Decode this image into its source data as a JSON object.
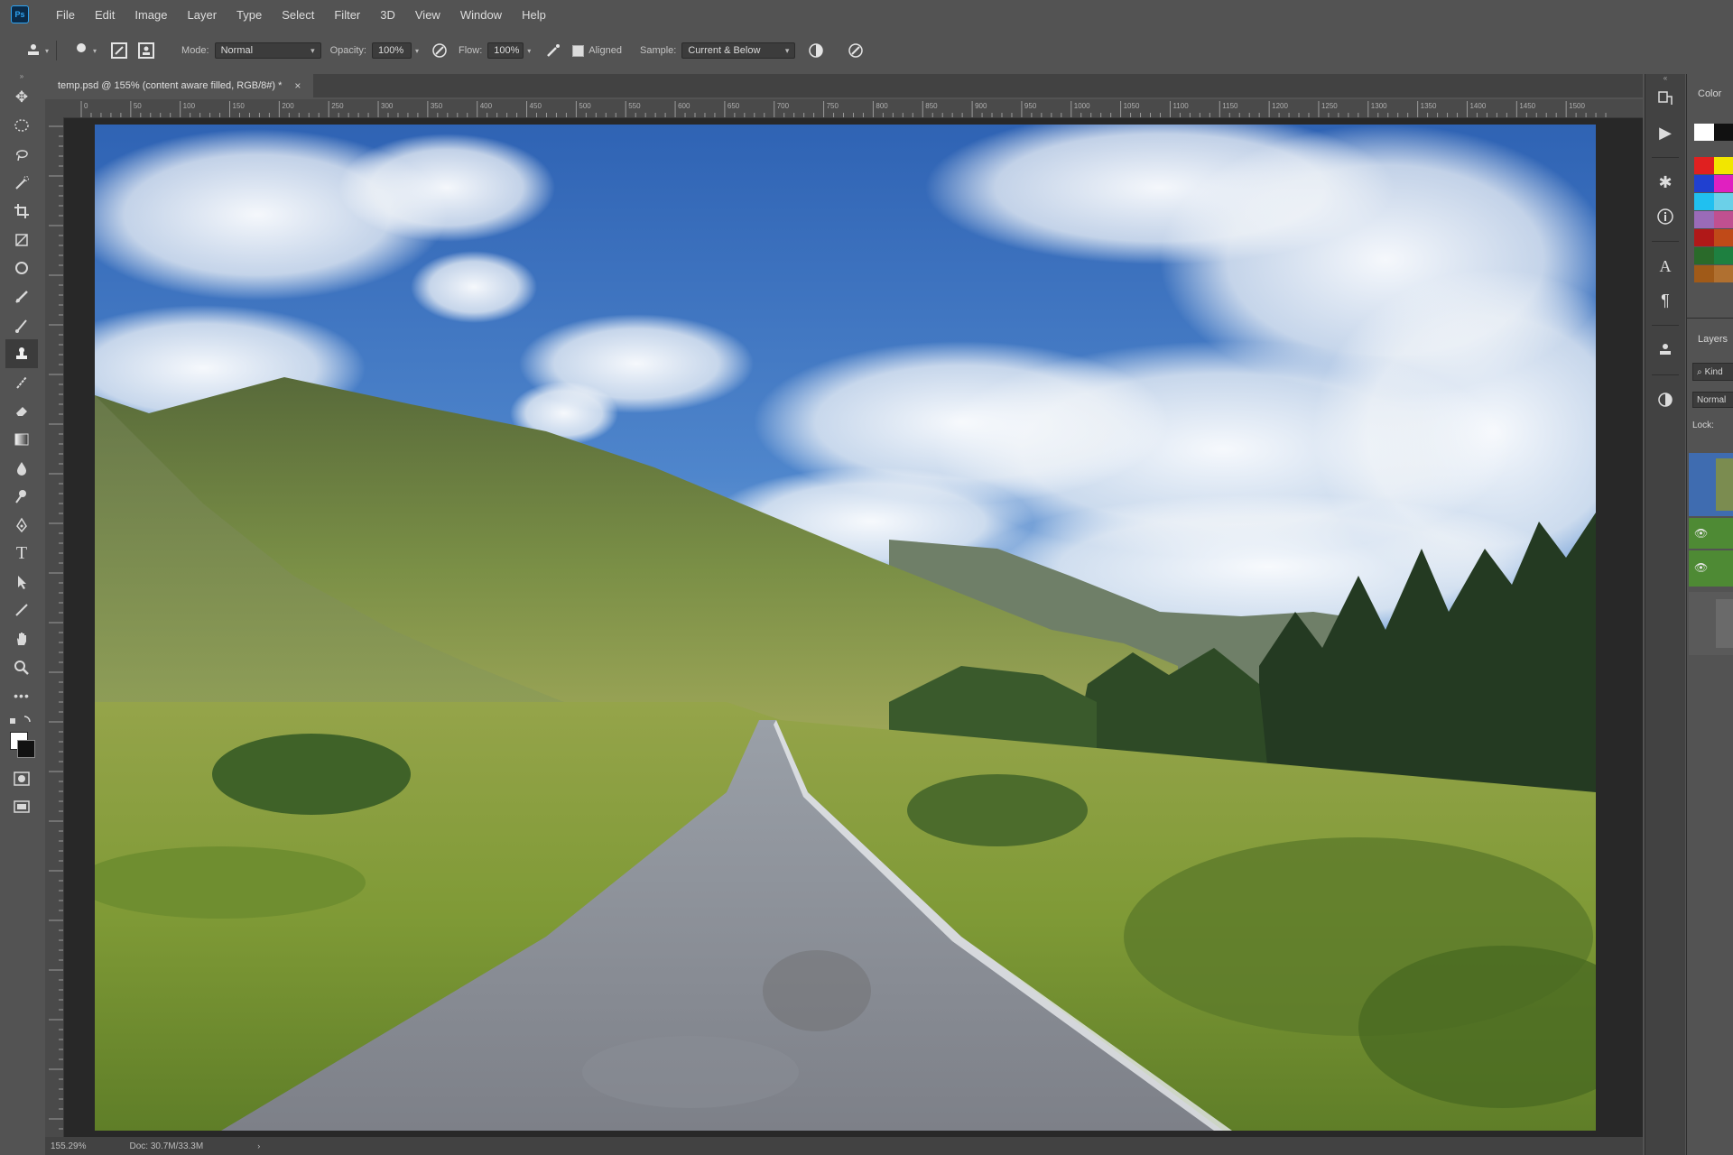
{
  "menubar": {
    "app_icon": "Ps",
    "items": [
      "File",
      "Edit",
      "Image",
      "Layer",
      "Type",
      "Select",
      "Filter",
      "3D",
      "View",
      "Window",
      "Help"
    ]
  },
  "options": {
    "mode_label": "Mode:",
    "mode_value": "Normal",
    "opacity_label": "Opacity:",
    "opacity_value": "100%",
    "flow_label": "Flow:",
    "flow_value": "100%",
    "aligned_label": "Aligned",
    "aligned_checked": true,
    "sample_label": "Sample:",
    "sample_value": "Current & Below"
  },
  "toolbar": {
    "active_tool": "clone-stamp",
    "tools": [
      "move",
      "marquee",
      "lasso",
      "quick-selection",
      "crop",
      "frame",
      "eyedropper",
      "spot-healing",
      "brush",
      "clone-stamp",
      "history-brush",
      "eraser",
      "gradient",
      "blur",
      "dodge",
      "pen",
      "type",
      "path-selection",
      "line",
      "hand",
      "zoom",
      "more"
    ],
    "foreground_color": "#ffffff",
    "background_color": "#111111"
  },
  "document": {
    "tab_title": "temp.psd @ 155% (content aware filled, RGB/8#) *",
    "tab_close": "×",
    "ruler_labels": [
      "0",
      "50",
      "100",
      "150",
      "200",
      "250",
      "300",
      "350",
      "400",
      "450",
      "500",
      "550",
      "600",
      "650",
      "700",
      "750",
      "800",
      "850",
      "900",
      "950",
      "1000",
      "1050",
      "1100",
      "1150",
      "1200",
      "1250",
      "1300",
      "1350",
      "1400",
      "1450",
      "1500"
    ]
  },
  "status": {
    "zoom": "155.29%",
    "doc_info": "Doc: 30.7M/33.3M"
  },
  "right_panel": {
    "color_tab": "Color",
    "layers_tab": "Layers",
    "search_hint": "Kind",
    "blend_mode": "Normal",
    "lock_label": "Lock:",
    "swatches": [
      "#ffffff",
      "#111111",
      "#e02020",
      "#f2e600",
      "#2040d0",
      "#e020c0",
      "#20c0f0",
      "#6bd0e8",
      "#9a6bb8",
      "#c05090",
      "#b01818",
      "#c04a18",
      "#2a6a2a",
      "#1e8040",
      "#a05a18",
      "#b07030"
    ]
  }
}
